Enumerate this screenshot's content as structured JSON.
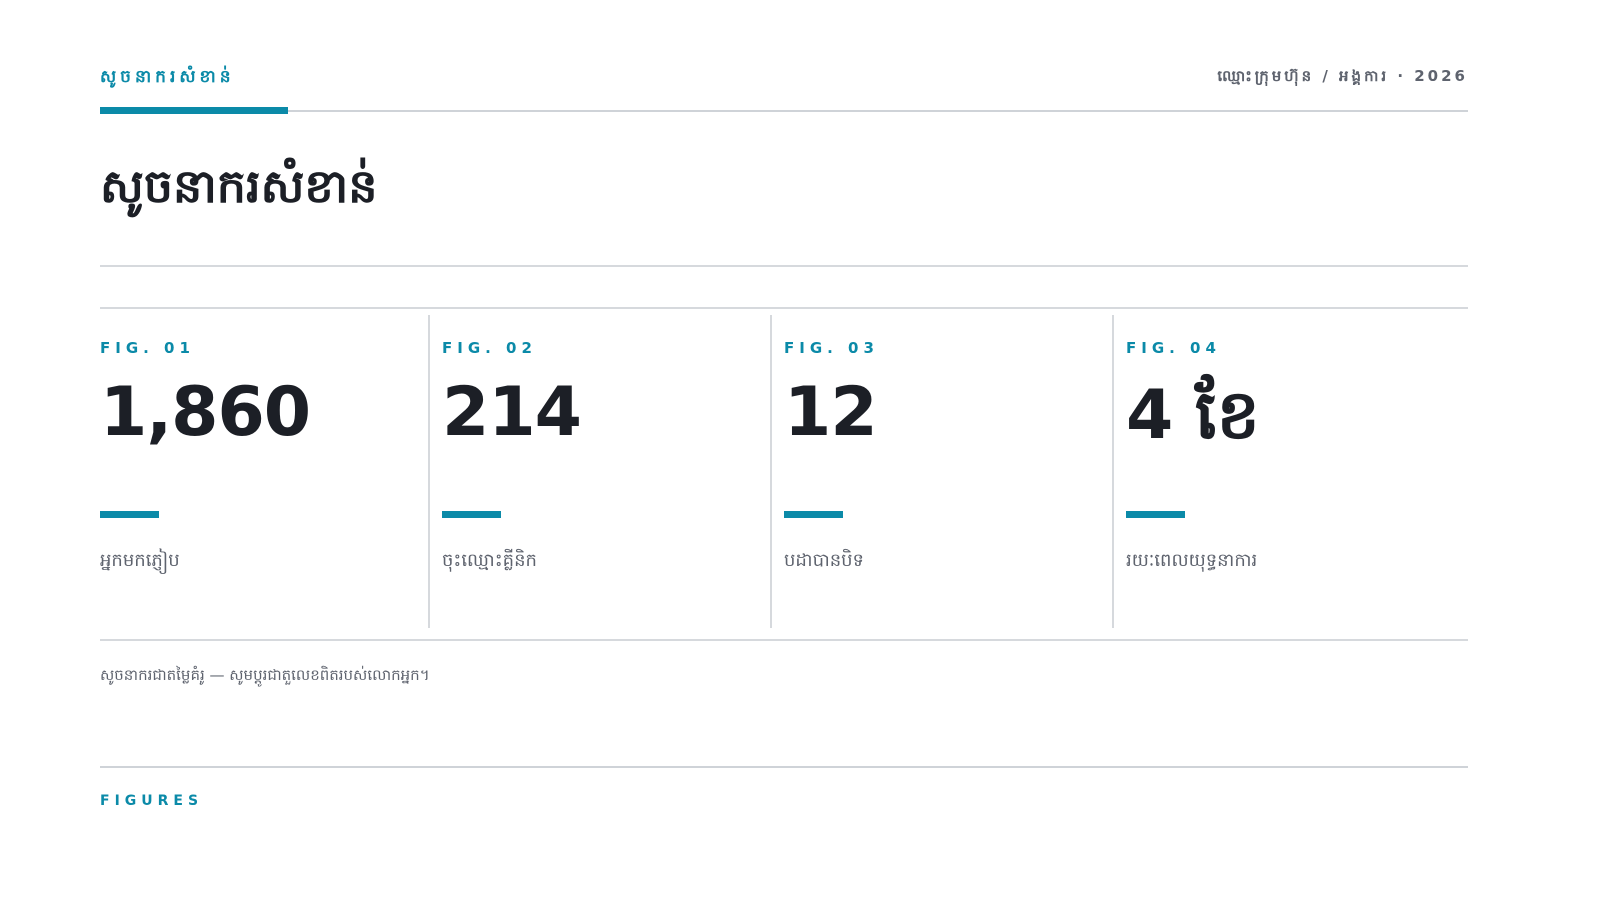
{
  "header": {
    "section_label": "សូចនាករសំខាន់",
    "meta": "ឈ្មោះក្រុមហ៊ុន / អង្គការ · 2026"
  },
  "page_title": "សូចនាករសំខាន់",
  "stats": [
    {
      "fig": "FIG. 01",
      "value": "1,860",
      "caption": "អ្នកមកភ្ញៀប"
    },
    {
      "fig": "FIG. 02",
      "value": "214",
      "caption": "ចុះឈ្មោះគ្លីនិក"
    },
    {
      "fig": "FIG. 03",
      "value": "12",
      "caption": "បដាបានបិទ"
    },
    {
      "fig": "FIG. 04",
      "value": "4 ខែ",
      "caption": "រយៈពេលយុទ្ធនាការ"
    }
  ],
  "note": "សូចនាករជាតម្លៃគំរូ — សូមប្តូរជាតួលេខពិតរបស់លោកអ្នក។",
  "footer": {
    "label": "FIGURES"
  },
  "colors": {
    "accent": "#0b8aa8",
    "text": "#1c1f26",
    "muted": "#5e636e",
    "rule": "#d6d9dd"
  }
}
